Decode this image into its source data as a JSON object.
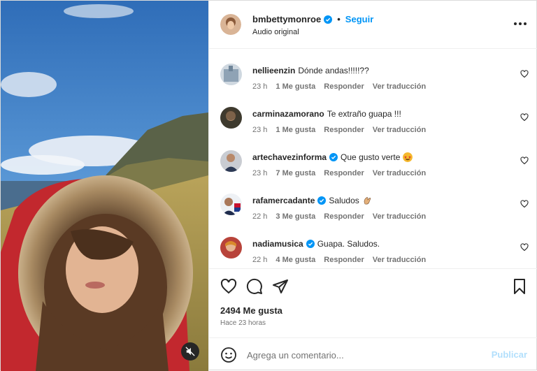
{
  "post": {
    "username": "bmbettymonroe",
    "separator": "•",
    "follow_label": "Seguir",
    "audio_label": "Audio original",
    "more_icon": "more-options-icon"
  },
  "comments": [
    {
      "user": "nellieenzin",
      "verified": false,
      "text": "Dónde andas!!!!!??",
      "emoji": "",
      "time": "23 h",
      "likes": "1 Me gusta",
      "reply": "Responder",
      "translate": "Ver traducción"
    },
    {
      "user": "carminazamorano",
      "verified": false,
      "text": "Te extraño guapa !!!",
      "emoji": "",
      "time": "23 h",
      "likes": "1 Me gusta",
      "reply": "Responder",
      "translate": "Ver traducción"
    },
    {
      "user": "artechavezinforma",
      "verified": true,
      "text": "Que gusto verte",
      "emoji": "star-struck-emoji",
      "time": "23 h",
      "likes": "7 Me gusta",
      "reply": "Responder",
      "translate": "Ver traducción"
    },
    {
      "user": "rafamercadante",
      "verified": true,
      "text": "Saludos",
      "emoji": "waving-hand-emoji",
      "time": "22 h",
      "likes": "3 Me gusta",
      "reply": "Responder",
      "translate": "Ver traducción"
    },
    {
      "user": "nadiamusica",
      "verified": true,
      "text": "Guapa. Saludos.",
      "emoji": "",
      "time": "22 h",
      "likes": "4 Me gusta",
      "reply": "Responder",
      "translate": "Ver traducción"
    }
  ],
  "stats": {
    "likes": "2494 Me gusta",
    "posted": "Hace 23 horas"
  },
  "composer": {
    "placeholder": "Agrega un comentario...",
    "publish_label": "Publicar"
  },
  "colors": {
    "accent": "#0095f6",
    "publish_disabled": "#b2dffc",
    "verified": "#0095f6",
    "text": "#262626",
    "muted": "#737373"
  },
  "icons": [
    "heart-icon",
    "comment-icon",
    "share-icon",
    "bookmark-icon",
    "emoji-icon",
    "mute-icon",
    "verified-icon"
  ]
}
